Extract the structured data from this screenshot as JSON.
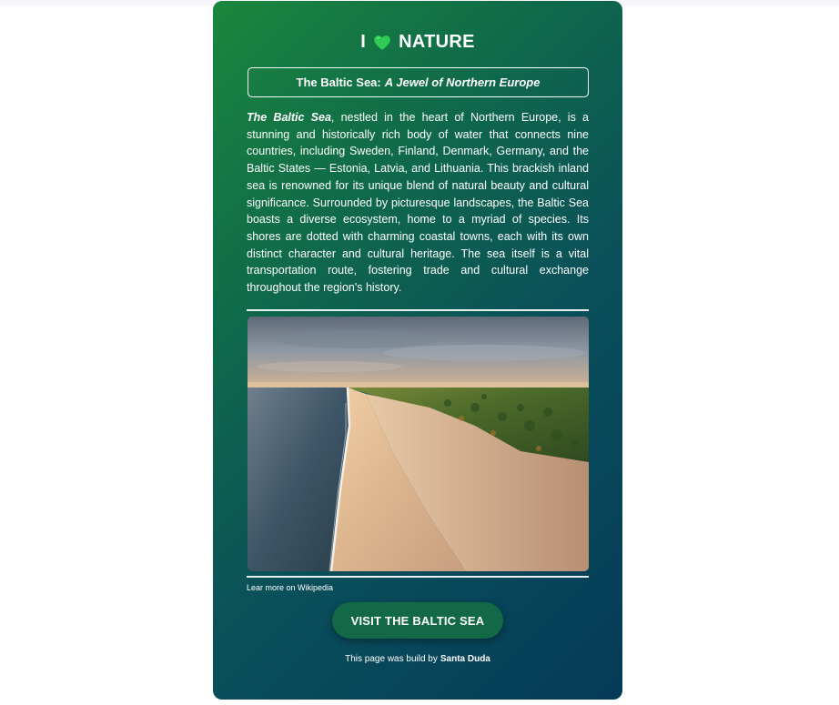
{
  "header": {
    "prefix": "I",
    "heart_icon": "green-heart-icon",
    "heart_color": "#2ecc55",
    "word": "NATURE"
  },
  "subtitle": {
    "plain": "The Baltic Sea:",
    "italic": "A Jewel of Northern Europe"
  },
  "article": {
    "lead": "The Baltic Sea",
    "text": ", nestled in the heart of Northern Europe, is a stunning and historically rich body of water that connects nine countries, including Sweden, Finland, Denmark, Germany, and the Baltic States — Estonia, Latvia, and Lithuania. This brackish inland sea is renowned for its unique blend of natural beauty and cultural significance. Surrounded by picturesque landscapes, the Baltic Sea boasts a diverse ecosystem, home to a myriad of species. Its shores are dotted with charming coastal towns, each with its own distinct character and cultural heritage. The sea itself is a vital transportation route, fostering trade and cultural exchange throughout the region's history."
  },
  "photo": {
    "subject": "aerial view of Baltic Sea coastline with sandy beach and pine forest"
  },
  "link": {
    "label": "Lear more on Wikipedia"
  },
  "button": {
    "label": "VISIT THE BALTIC SEA"
  },
  "footer": {
    "text": "This page was build by",
    "author": "Santa Duda"
  },
  "colors": {
    "gradient_start": "#1b873c",
    "gradient_end": "#053a58",
    "button_bg": "#136848"
  }
}
